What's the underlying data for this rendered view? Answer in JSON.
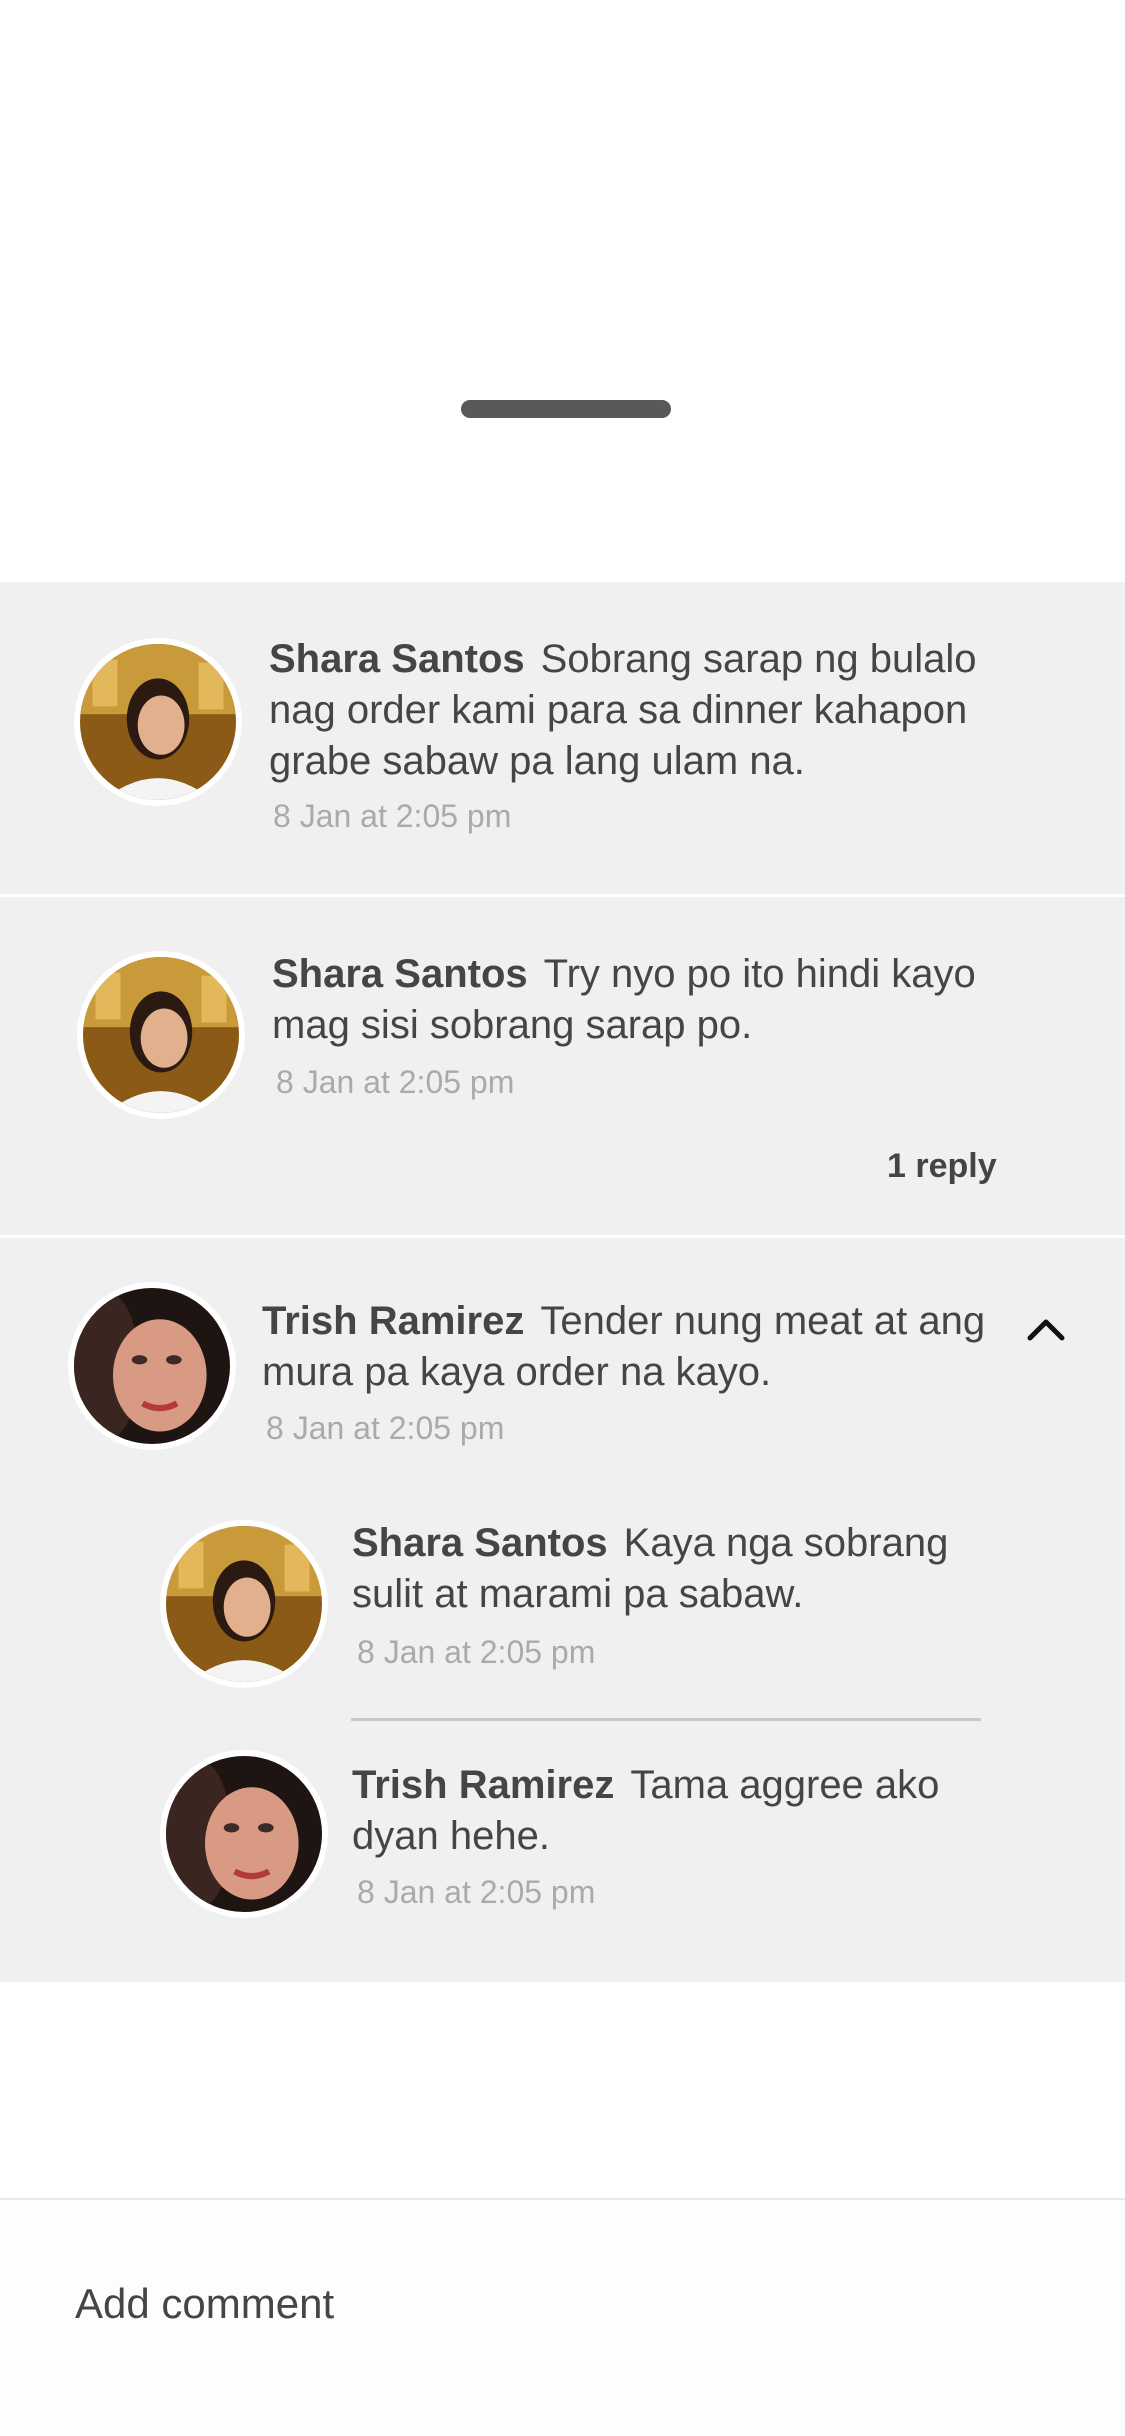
{
  "comments": [
    {
      "author": "Shara Santos",
      "text": "Sobrang sarap ng bulalo nag order kami para sa dinner kahapon grabe sabaw pa lang ulam na.",
      "time": "8 Jan at 2:05 pm",
      "avatar": "woman-chef-avatar"
    },
    {
      "author": "Shara Santos",
      "text": "Try nyo po ito hindi kayo mag sisi sobrang sarap po.",
      "time": "8 Jan at 2:05 pm",
      "avatar": "woman-chef-avatar",
      "replies_label": "1 reply"
    },
    {
      "author": "Trish Ramirez",
      "text": "Tender nung meat at ang mura pa kaya order na kayo.",
      "time": "8 Jan at 2:05 pm",
      "avatar": "woman-selfie-avatar",
      "replies": [
        {
          "author": "Shara Santos",
          "text": "Kaya nga sobrang sulit at marami pa sabaw.",
          "time": "8 Jan at 2:05 pm",
          "avatar": "woman-chef-avatar"
        },
        {
          "author": "Trish Ramirez",
          "text": "Tama aggree ako dyan hehe.",
          "time": "8 Jan at 2:05 pm",
          "avatar": "woman-selfie-avatar"
        }
      ]
    }
  ],
  "footer": {
    "add_comment_placeholder": "Add comment"
  },
  "icons": {
    "collapse": "chevron-up-icon",
    "handle": "drag-handle"
  }
}
